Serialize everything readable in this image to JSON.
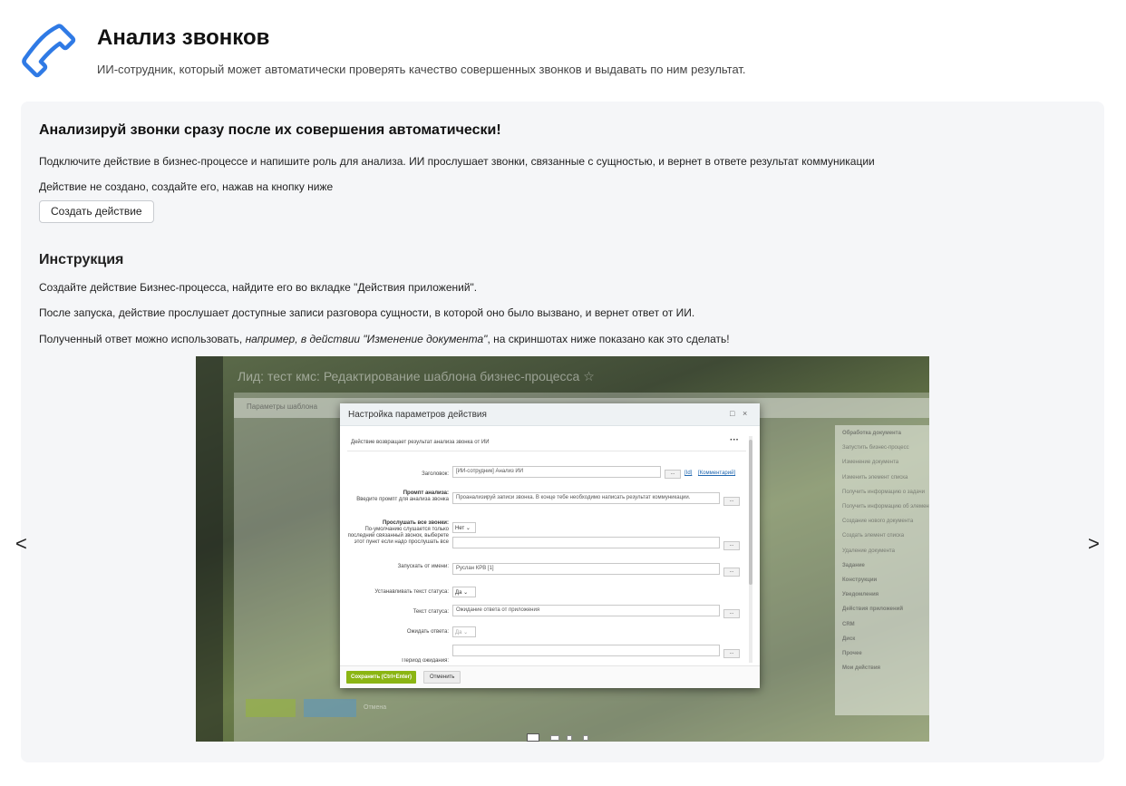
{
  "header": {
    "title": "Анализ звонков",
    "subtitle": "ИИ-сотрудник, который может автоматически проверять качество совершенных звонков и выдавать по ним результат."
  },
  "intro": {
    "title": "Анализируй звонки сразу после их совершения автоматически!",
    "text": "Подключите действие в бизнес-процессе и напишите роль для анализа. ИИ прослушает звонки, связанные с сущностью, и вернет в ответе результат коммуникации",
    "status_text": "Действие не создано, создайте его, нажав на кнопку ниже",
    "create_button": "Создать действие"
  },
  "instruction": {
    "title": "Инструкция",
    "step1": "Создайте действие Бизнес-процесса, найдите его во вкладке \"Действия приложений\".",
    "step2": "После запуска, действие прослушает доступные записи разговора сущности, в которой оно было вызвано, и вернет ответ от ИИ.",
    "step3_a": "Полученный ответ можно использовать, ",
    "step3_b": "например, в действии \"Изменение документа\"",
    "step3_c": ", на скриншотах ниже показано как это сделать!"
  },
  "carousel": {
    "prev": "<",
    "next": ">",
    "active_index": 0,
    "slide_count": 4,
    "slide": {
      "bg_title": "Лид: тест кмс: Редактирование шаблона бизнес-процесса ☆",
      "toolbar": "Параметры шаблона",
      "right_panel": [
        "Обработка документа",
        "Запустить бизнес-процесс",
        "Изменение документа",
        "Изменить элемент списка",
        "Получить информацию о задачи",
        "Получить информацию об элементе",
        "Создание нового документа",
        "Создать элемент списка",
        "Удаление документа",
        "Задание",
        "Конструкции",
        "Уведомления",
        "Действия приложений",
        "CRM",
        "Диск",
        "Прочее",
        "Мои действия"
      ],
      "bottom_save": "Сохранить",
      "bottom_apply": "Применить",
      "bottom_cancel": "Отмена",
      "dialog": {
        "title": "Настройка параметров действия",
        "description": "Действие возвращает результат анализа звонка от ИИ",
        "heading_label": "Заголовок:",
        "heading_value": "[ИИ-сотрудник] Анализ ИИ",
        "link_id": "[Id]",
        "link_comment": "[Комментарий]",
        "prompt_label_bold": "Промпт анализа:",
        "prompt_label": "Введите промпт для анализа звонка",
        "prompt_value": "Проанализируй записи звонка. В конце тебе необходимо написать результат коммуникации.",
        "listen_label_bold": "Прослушать все звонки:",
        "listen_label": "По-умолчанию слушается только последний связанный звонок, выберете этот пункт если надо прослушать все",
        "listen_value": "Нет",
        "run_as_label": "Запускать от имени:",
        "run_as_value": "Руслан КРВ [1]",
        "set_status_label": "Устанавливать текст статуса:",
        "set_status_value": "Да",
        "status_text_label": "Текст статуса:",
        "status_text_value": "Ожидание ответа от приложения",
        "wait_label": "Ожидать ответа:",
        "wait_value": "Да",
        "timeout_label": "Период ожидания:",
        "dots_button": "...",
        "save_button": "Сохранить (Ctrl+Enter)",
        "cancel_button": "Отменить"
      }
    }
  },
  "colors": {
    "icon_blue": "#2f7ae5",
    "card_bg": "#f5f6f8",
    "dialog_save": "#8bb513"
  }
}
